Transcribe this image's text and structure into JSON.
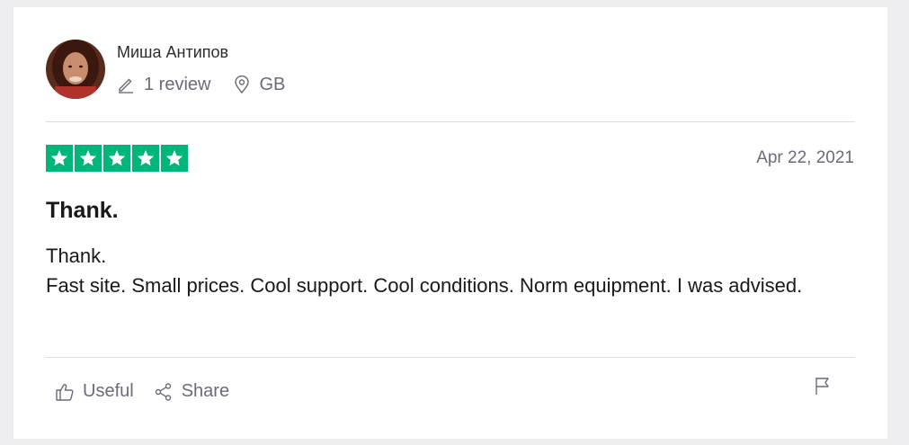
{
  "review": {
    "consumer": {
      "name": "Миша Антипов",
      "review_count": "1 review",
      "country": "GB"
    },
    "rating": 5,
    "date": "Apr 22, 2021",
    "title": "Thank.",
    "body": "Thank.\nFast site. Small prices. Cool support. Cool conditions. Norm equipment. I was advised.",
    "actions": {
      "useful_label": "Useful",
      "share_label": "Share"
    }
  },
  "colors": {
    "star": "#00b67a",
    "muted_text": "#6b6b7c",
    "divider": "#dcdce6"
  },
  "icons": [
    "pencil-icon",
    "location-pin-icon",
    "star-icon",
    "thumbs-up-icon",
    "share-icon",
    "flag-icon"
  ]
}
